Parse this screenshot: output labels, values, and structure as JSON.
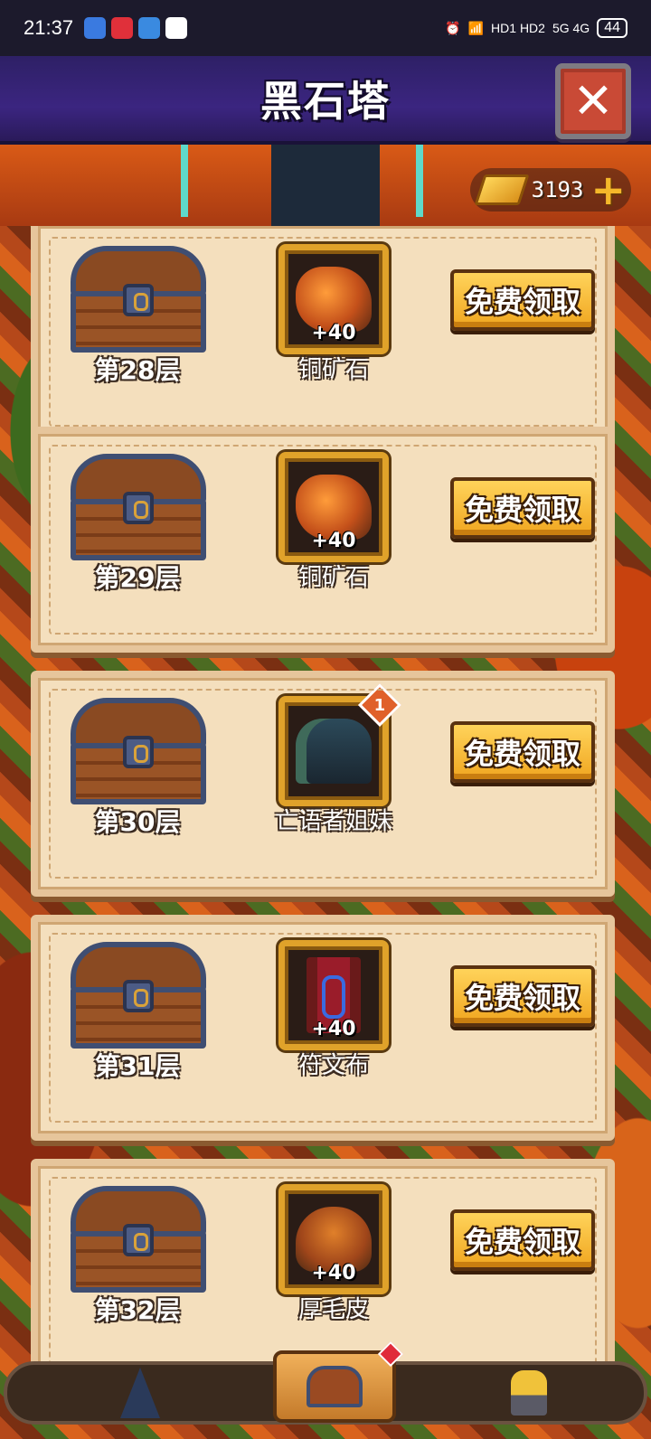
{
  "status_bar": {
    "time": "21:37",
    "network": "5G 4G",
    "hd": "HD1 HD2",
    "battery": "44"
  },
  "header": {
    "title": "黑石塔",
    "close_symbol": "✕"
  },
  "currency": {
    "value": "3193",
    "plus": "+"
  },
  "claim_label": "免费领取",
  "floors": [
    {
      "floor": "第28层",
      "reward_name": "铜矿石",
      "reward_count": "+40",
      "reward_icon": "copper-ore-icon"
    },
    {
      "floor": "第29层",
      "reward_name": "铜矿石",
      "reward_count": "+40",
      "reward_icon": "copper-ore-icon"
    },
    {
      "floor": "第30层",
      "reward_name": "亡语者姐妹",
      "reward_count": "",
      "badge": "1",
      "reward_icon": "hero-portrait-icon"
    },
    {
      "floor": "第31层",
      "reward_name": "符文布",
      "reward_count": "+40",
      "reward_icon": "rune-cloth-icon"
    },
    {
      "floor": "第32层",
      "reward_name": "厚毛皮",
      "reward_count": "+40",
      "reward_icon": "thick-fur-icon"
    }
  ],
  "bottom_nav": [
    {
      "name": "tower",
      "icon": "tower-icon"
    },
    {
      "name": "chest",
      "icon": "chest-icon",
      "active": true
    },
    {
      "name": "ranking",
      "icon": "trophy-icon"
    }
  ],
  "colors": {
    "header": "#3b2580",
    "button": "#f0a620",
    "card": "#f4dfbd",
    "frame": "#e0a22a"
  }
}
